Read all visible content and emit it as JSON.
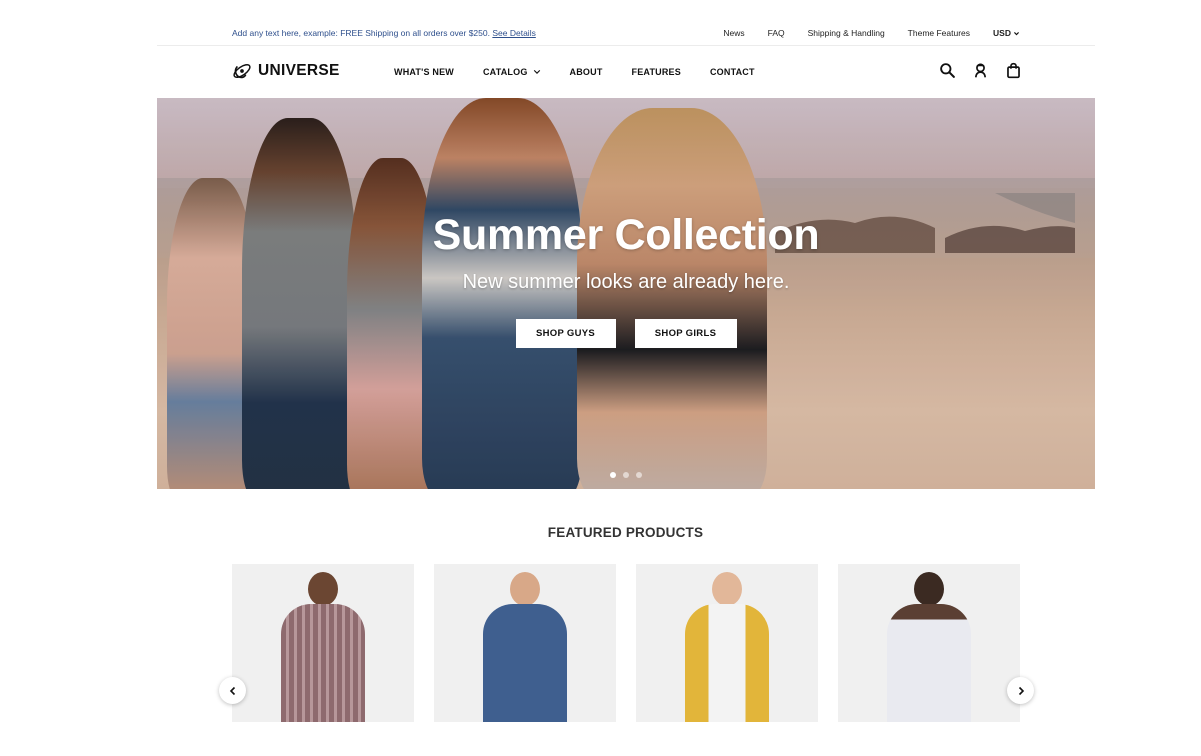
{
  "announcement": {
    "text": "Add any text here, example: FREE Shipping on all orders over $250.",
    "link": "See Details"
  },
  "utility_links": [
    "News",
    "FAQ",
    "Shipping & Handling",
    "Theme Features"
  ],
  "currency": "USD",
  "brand": {
    "name": "UNIVERSE",
    "logo_icon": "universe-logo-icon"
  },
  "nav": {
    "items": [
      {
        "label": "WHAT'S NEW"
      },
      {
        "label": "CATALOG",
        "has_dropdown": true
      },
      {
        "label": "ABOUT"
      },
      {
        "label": "FEATURES"
      },
      {
        "label": "CONTACT"
      }
    ]
  },
  "header_icons": [
    "search-icon",
    "account-icon",
    "cart-icon"
  ],
  "hero": {
    "title": "Summer Collection",
    "subtitle": "New summer looks are already here.",
    "buttons": [
      "SHOP GUYS",
      "SHOP GIRLS"
    ],
    "slides": 3,
    "active_slide": 1
  },
  "featured": {
    "title": "FEATURED PRODUCTS",
    "products": [
      {
        "image": "man in plaid shirt",
        "head_color": "#6b4632",
        "body_color": "#8e6a6e"
      },
      {
        "image": "woman in denim dress",
        "head_color": "#d8a888",
        "body_color": "#3f5f8f"
      },
      {
        "image": "man in yellow jacket",
        "head_color": "#e2b799",
        "body_color": "#e2b53a"
      },
      {
        "image": "woman in white dress",
        "head_color": "#3b2a22",
        "body_color": "#e9eaf0"
      }
    ]
  },
  "colors": {
    "announce_link": "#2e4f8c",
    "text": "#111111"
  }
}
